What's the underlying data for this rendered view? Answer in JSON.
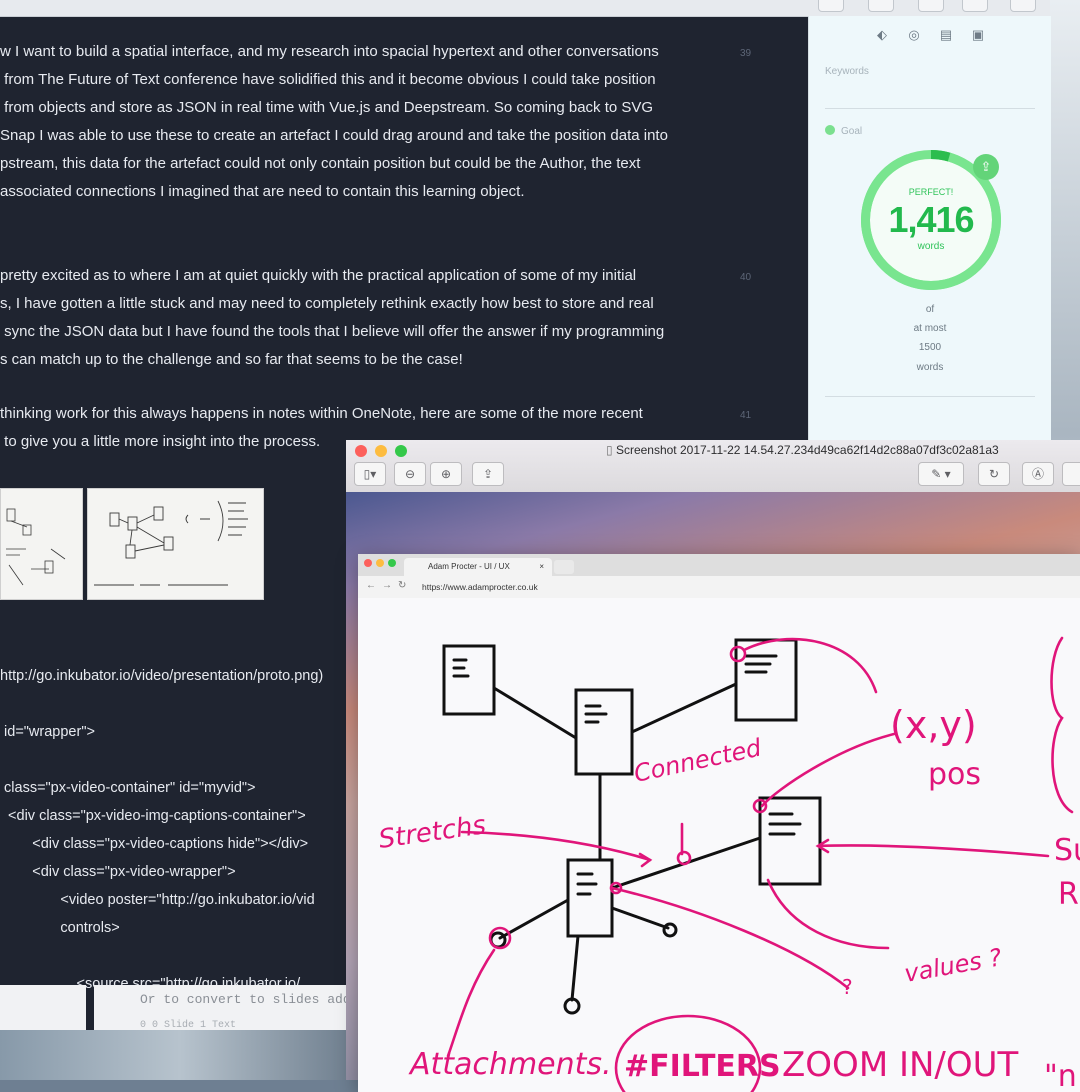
{
  "editor": {
    "paragraphs": [
      {
        "num": "39",
        "lines": [
          "w I want to build a spatial interface, and my research into spacial hypertext and other conversations",
          " from The Future of Text conference have solidified this and it become obvious I could take position",
          " from objects and store as JSON in real time with Vue.js and Deepstream. So coming back to SVG",
          "Snap I was able to use these to create an artefact I could drag around and take the position data into",
          "pstream, this data for the artefact could not only contain position but could be the Author, the text",
          "associated connections I imagined that are need to contain this learning object."
        ]
      },
      {
        "num": "40",
        "lines": [
          "pretty excited as to where I am at quiet quickly with the practical application of some of my initial",
          "s, I have gotten a little stuck and may need to completely rethink exactly how best to store and real",
          " sync the JSON data but I have found the tools that I believe will offer the answer if my programming",
          "s can match up to the challenge and so far that seems to be the case!"
        ]
      },
      {
        "num": "41",
        "lines": [
          "thinking work for this always happens in notes within OneNote, here are some of the more recent",
          " to give you a little more insight into the process."
        ]
      }
    ],
    "code_lines": [
      "http://go.inkubator.io/video/presentation/proto.png)",
      " id=\"wrapper\">",
      " class=\"px-video-container\" id=\"myvid\">",
      "  <div class=\"px-video-img-captions-container\">",
      "        <div class=\"px-video-captions hide\"></div>",
      "        <div class=\"px-video-wrapper\">",
      "               <video poster=\"http://go.inkubator.io/vid",
      "               controls>",
      "                   <source src=\"http://go.inkubator.io/"
    ],
    "footer_text": "Or to convert to slides add",
    "footer_text_2": "0 0   Slide  1  Text"
  },
  "sidebar": {
    "keywords_label": "Keywords",
    "goal_label": "Goal",
    "goal_status": "PERFECT!",
    "word_count": "1,416",
    "unit": "words",
    "of_label": "of",
    "limit_label": "at most",
    "goal_target": "1500",
    "goal_unit": "words",
    "goal_progress": 0.944
  },
  "screenshot_window": {
    "title": "Screenshot 2017-11-22 14.54.27.234d49ca62f14d2c88a07df3c02a81a3",
    "browser_tab": "Adam Procter - UI / UX",
    "url": "https://www.adamprocter.co.uk",
    "sketch_labels": {
      "connected": "Connected",
      "stretchs": "Stretchs",
      "xy": "(x,y)",
      "pos": "pos",
      "values": "values ?",
      "question": "?",
      "attachments": "Attachments.",
      "filters": "#FILTERS",
      "zoom": "ZOOM IN/OUT",
      "quote": "\"n",
      "su": "Su",
      "r": "R"
    }
  },
  "colors": {
    "editor_bg": "#1f2430",
    "editor_text": "#e7eaf0",
    "goal_green": "#2fc35a",
    "ink": "#e0157a"
  }
}
